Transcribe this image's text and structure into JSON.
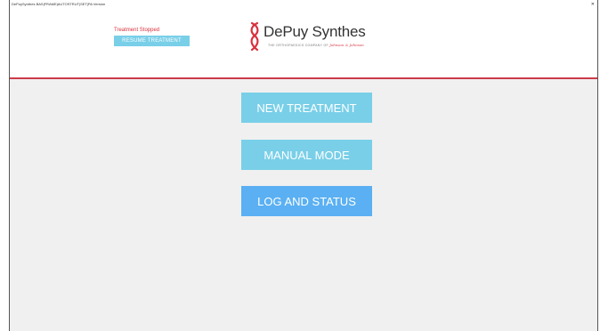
{
  "window": {
    "title": "DePuySynthes BAS|FRAME|AUTOSTRUT|SET|PA Version",
    "close_glyph": "✕"
  },
  "header": {
    "status_text": "Treatment Stopped",
    "resume_button_label": "RESUME TREATMENT",
    "logo": {
      "name": "DePuy Synthes",
      "tagline": "THE ORTHOPAEDICS COMPANY OF",
      "tagline_brand": "Johnson & Johnson"
    },
    "divider_color": "#cc3b4a"
  },
  "menu": {
    "new_treatment_label": "NEW TREATMENT",
    "manual_mode_label": "MANUAL MODE",
    "log_status_label": "LOG AND STATUS"
  },
  "colors": {
    "button_primary": "#79cfe8",
    "button_active": "#5ab0f2",
    "status_red": "#d8323f",
    "background": "#f0f0f0"
  }
}
